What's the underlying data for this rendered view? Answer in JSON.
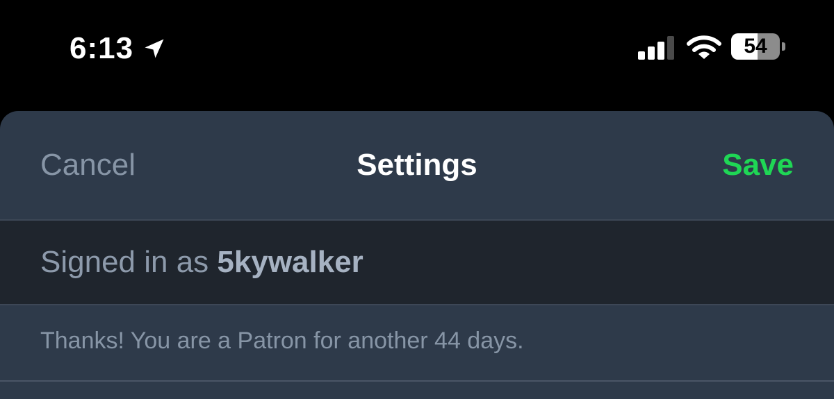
{
  "status_bar": {
    "time": "6:13",
    "location_icon": "location-arrow-icon",
    "signal_icon": "cellular-signal-icon",
    "wifi_icon": "wifi-icon",
    "battery_percent": "54",
    "battery_level": 0.54
  },
  "nav": {
    "cancel_label": "Cancel",
    "title": "Settings",
    "save_label": "Save",
    "save_color": "#1fd655"
  },
  "account": {
    "signed_in_prefix": "Signed in as ",
    "username": "5kywalker"
  },
  "patron": {
    "message": "Thanks! You are a Patron for another 44 days."
  }
}
